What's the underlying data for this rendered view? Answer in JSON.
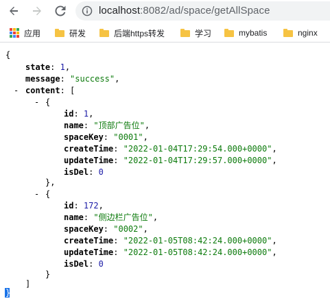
{
  "browser": {
    "url_host": "localhost",
    "url_rest": ":8082/ad/space/getAllSpace",
    "bookmarks": [
      {
        "label": "应用",
        "icon": "apps-grid-icon"
      },
      {
        "label": "研发",
        "icon": "folder-icon"
      },
      {
        "label": "后端https转发",
        "icon": "folder-icon"
      },
      {
        "label": "学习",
        "icon": "folder-icon"
      },
      {
        "label": "mybatis",
        "icon": "folder-icon"
      },
      {
        "label": "nginx",
        "icon": "folder-icon"
      }
    ],
    "colors": {
      "folder": "#f6c343",
      "omnibox_bg": "#f1f3f4"
    }
  },
  "json": {
    "open_brace": "{",
    "close_brace": "}",
    "toggle": "-",
    "state_key": "state",
    "state_val": "1",
    "message_key": "message",
    "message_val": "\"success\"",
    "content_key": "content",
    "open_bracket": "[",
    "close_bracket": "]",
    "items": [
      {
        "id_key": "id",
        "id_val": "1",
        "name_key": "name",
        "name_val": "\"顶部广告位\"",
        "spaceKey_key": "spaceKey",
        "spaceKey_val": "\"0001\"",
        "createTime_key": "createTime",
        "createTime_val": "\"2022-01-04T17:29:54.000+0000\"",
        "updateTime_key": "updateTime",
        "updateTime_val": "\"2022-01-04T17:29:57.000+0000\"",
        "isDel_key": "isDel",
        "isDel_val": "0"
      },
      {
        "id_key": "id",
        "id_val": "172",
        "name_key": "name",
        "name_val": "\"侧边栏广告位\"",
        "spaceKey_key": "spaceKey",
        "spaceKey_val": "\"0002\"",
        "createTime_key": "createTime",
        "createTime_val": "\"2022-01-05T08:42:24.000+0000\"",
        "updateTime_key": "updateTime",
        "updateTime_val": "\"2022-01-05T08:42:24.000+0000\"",
        "isDel_key": "isDel",
        "isDel_val": "0"
      }
    ]
  }
}
